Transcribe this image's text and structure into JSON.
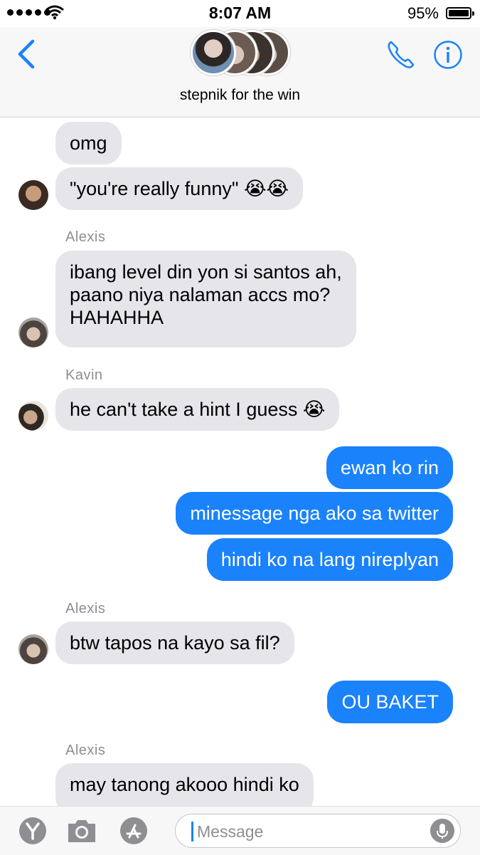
{
  "status_bar": {
    "time": "8:07 AM",
    "battery": "95%"
  },
  "header": {
    "group_name": "stepnik for the win"
  },
  "messages": [
    {
      "type": "in",
      "text": "omg"
    },
    {
      "type": "in",
      "text": "\"you're really funny\" 😭😭"
    },
    {
      "type": "sender",
      "text": "Alexis"
    },
    {
      "type": "in",
      "lines": [
        "ibang level din yon si santos ah,",
        "paano niya nalaman accs mo?",
        "HAHAHHA"
      ]
    },
    {
      "type": "sender",
      "text": "Kavin"
    },
    {
      "type": "in",
      "text": "he can't take a hint I guess 😭"
    },
    {
      "type": "out",
      "text": "ewan ko rin"
    },
    {
      "type": "out",
      "text": "minessage nga ako sa twitter"
    },
    {
      "type": "out",
      "text": "hindi ko na lang nireplyan"
    },
    {
      "type": "sender",
      "text": "Alexis"
    },
    {
      "type": "in",
      "text": "btw tapos na kayo sa fil?"
    },
    {
      "type": "out",
      "text": "OU BAKET"
    },
    {
      "type": "sender",
      "text": "Alexis"
    },
    {
      "type": "in",
      "text": "may tanong akooo hindi ko"
    }
  ],
  "input_bar": {
    "placeholder": "Message"
  },
  "icons": {
    "back": "chevron-left-icon",
    "call": "phone-icon",
    "info": "info-icon",
    "yahoo": "y-app-icon",
    "camera": "camera-icon",
    "appstore": "app-store-icon",
    "mic": "microphone-icon"
  },
  "colors": {
    "accent": "#1a82fb",
    "incoming_bubble": "#e5e5ea",
    "outgoing_bubble": "#1a82fb",
    "sender_label": "#8e8e93"
  }
}
